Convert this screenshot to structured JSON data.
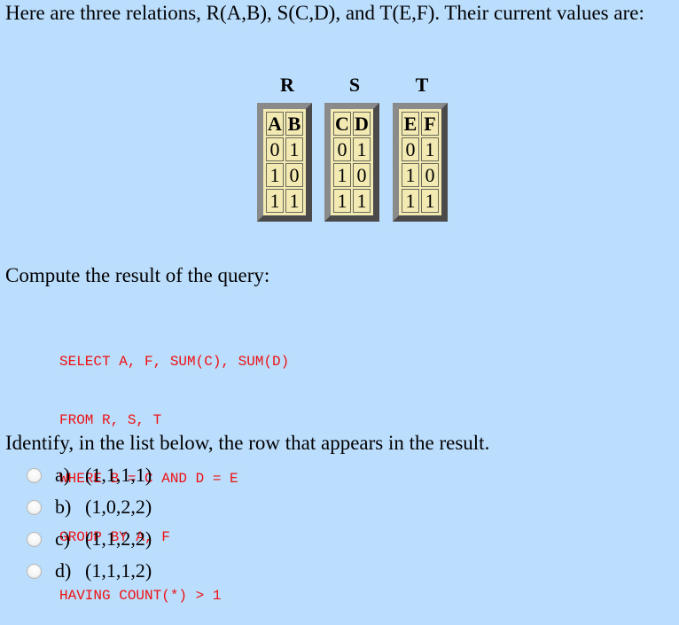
{
  "intro": "Here are three relations, R(A,B), S(C,D), and T(E,F). Their current values are:",
  "relations": [
    {
      "name": "R",
      "columns": [
        "A",
        "B"
      ],
      "rows": [
        [
          "0",
          "1"
        ],
        [
          "1",
          "0"
        ],
        [
          "1",
          "1"
        ]
      ]
    },
    {
      "name": "S",
      "columns": [
        "C",
        "D"
      ],
      "rows": [
        [
          "0",
          "1"
        ],
        [
          "1",
          "0"
        ],
        [
          "1",
          "1"
        ]
      ]
    },
    {
      "name": "T",
      "columns": [
        "E",
        "F"
      ],
      "rows": [
        [
          "0",
          "1"
        ],
        [
          "1",
          "0"
        ],
        [
          "1",
          "1"
        ]
      ]
    }
  ],
  "compute_label": "Compute the result of the query:",
  "query_lines": [
    "SELECT A, F, SUM(C), SUM(D)",
    "FROM R, S, T",
    "WHERE B = C AND D = E",
    "GROUP BY A, F",
    "HAVING COUNT(*) > 1"
  ],
  "identify_label": "Identify, in the list below, the row that appears in the result.",
  "options": [
    {
      "letter": "a)",
      "value": "(1,1,1,1)",
      "selected": false
    },
    {
      "letter": "b)",
      "value": "(1,0,2,2)",
      "selected": false
    },
    {
      "letter": "c)",
      "value": "(1,1,2,2)",
      "selected": false
    },
    {
      "letter": "d)",
      "value": "(1,1,1,2)",
      "selected": false
    }
  ],
  "colors": {
    "background": "#bbddfe",
    "query_text": "#ee1111",
    "table_cell": "#f2eab2"
  }
}
